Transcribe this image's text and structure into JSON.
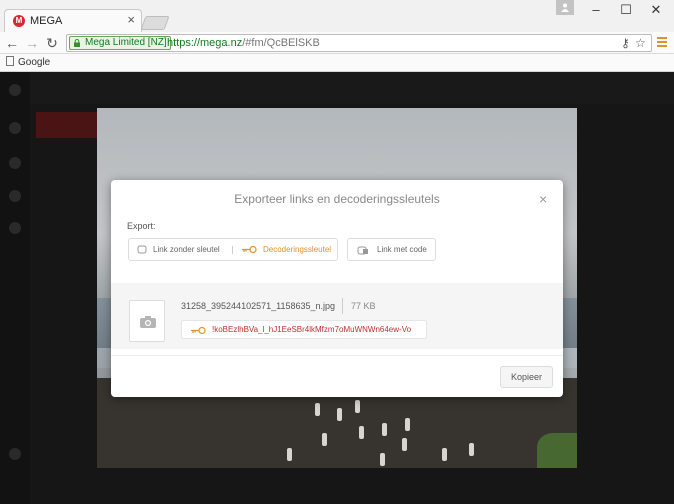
{
  "browser": {
    "tab_title": "MEGA",
    "tab_favicon_letter": "M",
    "ev_label": "Mega Limited [NZ]",
    "url_secure": "https://mega.nz",
    "url_rest": "/#fm/QcBElSKB",
    "bookmark": "Google"
  },
  "dialog": {
    "title": "Exporteer links en decoderingssleutels",
    "export_label": "Export:",
    "options": {
      "link_without_key": "Link zonder sleutel",
      "decryption_key": "Decoderingssleutel",
      "link_with_code": "Link met code"
    },
    "file": {
      "name": "31258_395244102571_1158635_n.jpg",
      "size": "77 KB",
      "key": "!koBEzlhBVa_l_hJ1EeSBr4lkMfzm7oMuWNWn64ew-Vo"
    },
    "copy_button": "Kopieer"
  },
  "colors": {
    "accent_orange": "#e38f2c",
    "key_red": "#c0302e",
    "ev_green": "#127a20"
  }
}
